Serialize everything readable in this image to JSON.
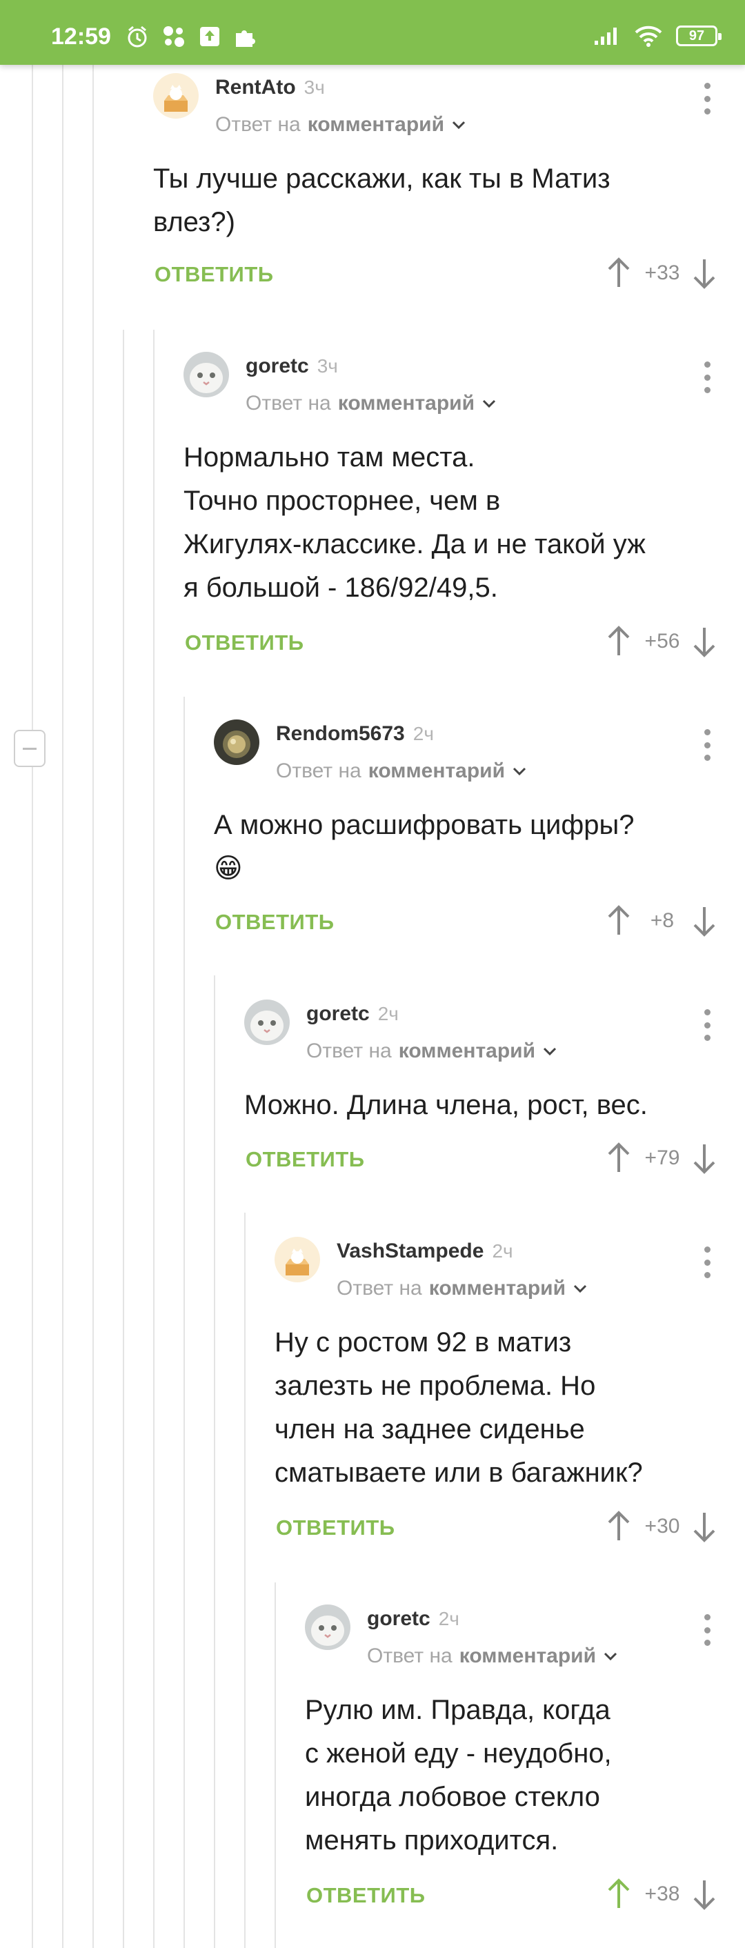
{
  "status_bar": {
    "time": "12:59",
    "battery": "97"
  },
  "comments": [
    {
      "author": "RentAto",
      "time": "3ч",
      "reply_prefix": "Ответ на",
      "reply_target": "комментарий",
      "text_lines": [
        "Ты лучше расскажи, как ты в Матиз",
        "влез?)"
      ],
      "reply_label": "ОТВЕТИТЬ",
      "score": "+33",
      "avatar": "cat-in-box-avatar"
    },
    {
      "author": "goretc",
      "time": "3ч",
      "reply_prefix": "Ответ на",
      "reply_target": "комментарий",
      "text_lines": [
        "Нормально там места.",
        "Точно просторнее, чем в",
        "Жигулях-классике. Да и не такой уж",
        "я большой - 186/92/49,5."
      ],
      "reply_label": "ОТВЕТИТЬ",
      "score": "+56",
      "avatar": "white-cat-avatar"
    },
    {
      "author": "Rendom5673",
      "time": "2ч",
      "reply_prefix": "Ответ на",
      "reply_target": "комментарий",
      "text_lines": [
        "А можно расшифровать цифры?",
        "😁"
      ],
      "reply_label": "ОТВЕТИТЬ",
      "score": "+8",
      "avatar": "photo-avatar"
    },
    {
      "author": "goretc",
      "time": "2ч",
      "reply_prefix": "Ответ на",
      "reply_target": "комментарий",
      "text_lines": [
        "Можно. Длина члена, рост, вес."
      ],
      "reply_label": "ОТВЕТИТЬ",
      "score": "+79",
      "avatar": "white-cat-avatar"
    },
    {
      "author": "VashStampede",
      "time": "2ч",
      "reply_prefix": "Ответ на",
      "reply_target": "комментарий",
      "text_lines": [
        "Ну с ростом 92 в матиз",
        "залезть не проблема. Но",
        "член на заднее сиденье",
        "сматываете или в багажник?"
      ],
      "reply_label": "ОТВЕТИТЬ",
      "score": "+30",
      "avatar": "cat-in-box-avatar"
    },
    {
      "author": "goretc",
      "time": "2ч",
      "reply_prefix": "Ответ на",
      "reply_target": "комментарий",
      "text_lines": [
        "Рулю им. Правда, когда",
        "с женой еду - неудобно,",
        "иногда лобовое стекло",
        "менять приходится."
      ],
      "reply_label": "ОТВЕТИТЬ",
      "score": "+38",
      "avatar": "white-cat-avatar",
      "upvoted": true
    }
  ],
  "colors": {
    "accent": "#86bd52",
    "statusbar": "#82bf4f",
    "upvoted": "#86bd52"
  }
}
